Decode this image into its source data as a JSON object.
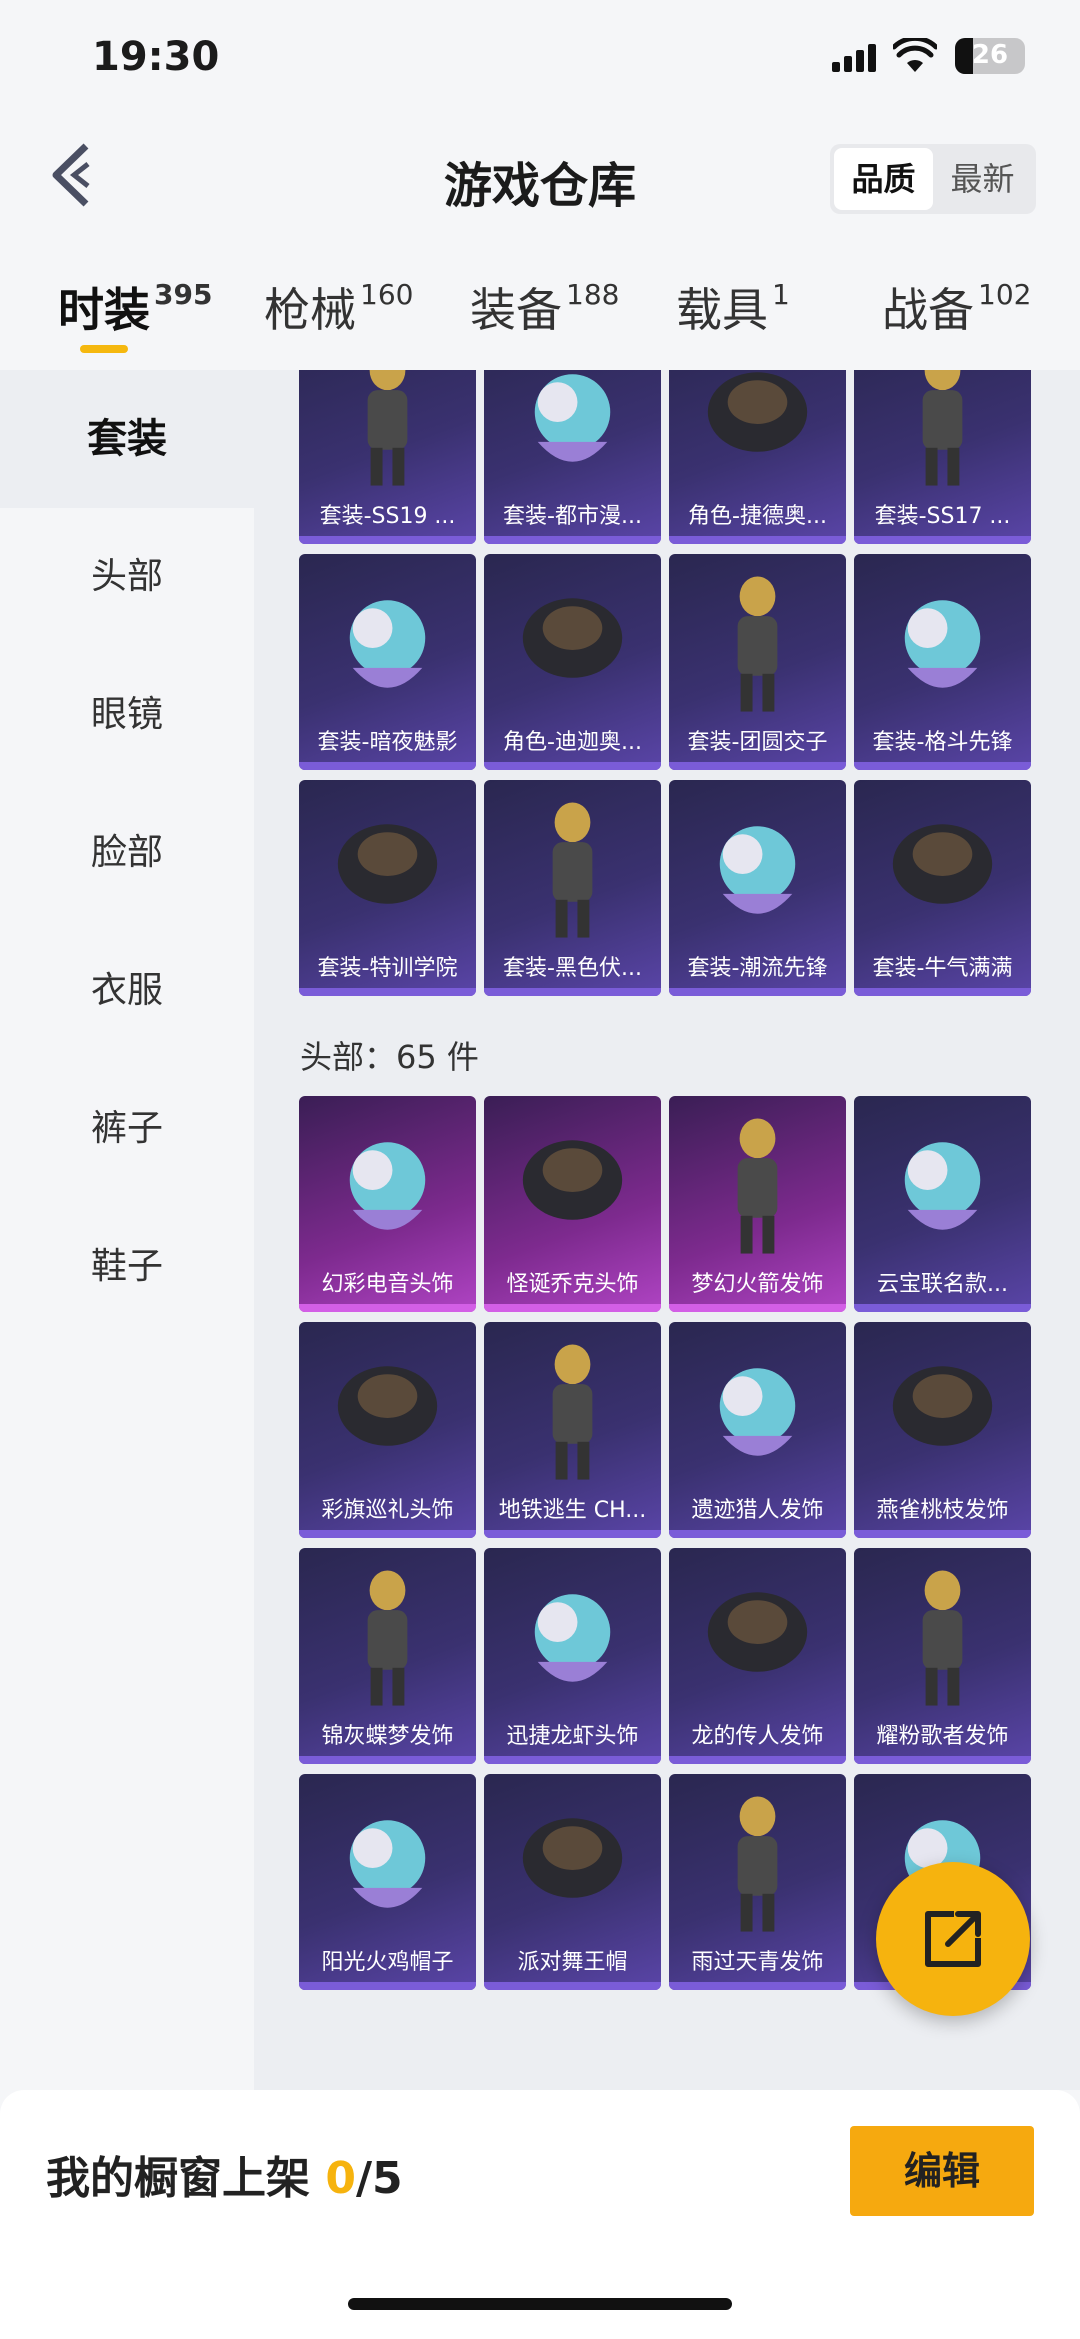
{
  "status": {
    "time": "19:30",
    "battery": "26"
  },
  "header": {
    "title": "游戏仓库",
    "sort_options": [
      "品质",
      "最新"
    ]
  },
  "tabs": [
    {
      "label": "时装",
      "count": "395"
    },
    {
      "label": "枪械",
      "count": "160"
    },
    {
      "label": "装备",
      "count": "188"
    },
    {
      "label": "载具",
      "count": "1"
    },
    {
      "label": "战备",
      "count": "102"
    }
  ],
  "sidebar": [
    {
      "label": "套装"
    },
    {
      "label": "头部"
    },
    {
      "label": "眼镜"
    },
    {
      "label": "脸部"
    },
    {
      "label": "衣服"
    },
    {
      "label": "裤子"
    },
    {
      "label": "鞋子"
    }
  ],
  "suits": [
    "套装-SS19 ...",
    "套装-都市漫...",
    "角色-捷德奥...",
    "套装-SS17 ...",
    "套装-暗夜魅影",
    "角色-迪迦奥...",
    "套装-团圆交子",
    "套装-格斗先锋",
    "套装-特训学院",
    "套装-黑色伏...",
    "套装-潮流先锋",
    "套装-牛气满满"
  ],
  "head_section": {
    "label": "头部：65 件"
  },
  "heads": [
    {
      "name": "幻彩电音头饰",
      "rarity": "pink"
    },
    {
      "name": "怪诞乔克头饰",
      "rarity": "pink"
    },
    {
      "name": "梦幻火箭发饰",
      "rarity": "pink"
    },
    {
      "name": "云宝联名款...",
      "rarity": "purple"
    },
    {
      "name": "彩旗巡礼头饰",
      "rarity": "purple"
    },
    {
      "name": "地铁逃生 CH...",
      "rarity": "purple"
    },
    {
      "name": "遗迹猎人发饰",
      "rarity": "purple"
    },
    {
      "name": "燕雀桃枝发饰",
      "rarity": "purple"
    },
    {
      "name": "锦灰蝶梦发饰",
      "rarity": "purple"
    },
    {
      "name": "迅捷龙虾头饰",
      "rarity": "purple"
    },
    {
      "name": "龙的传人发饰",
      "rarity": "purple"
    },
    {
      "name": "耀粉歌者发饰",
      "rarity": "purple"
    },
    {
      "name": "阳光火鸡帽子",
      "rarity": "purple"
    },
    {
      "name": "派对舞王帽",
      "rarity": "purple"
    },
    {
      "name": "雨过天青发饰",
      "rarity": "purple"
    },
    {
      "name": "",
      "rarity": "purple"
    }
  ],
  "bottom": {
    "label": "我的橱窗上架",
    "count": "0",
    "total": "/5",
    "edit": "编辑"
  },
  "colors": {
    "accent": "#f6b30e",
    "card_purple": "#3a3170",
    "card_pink": "#7d2a8e"
  }
}
